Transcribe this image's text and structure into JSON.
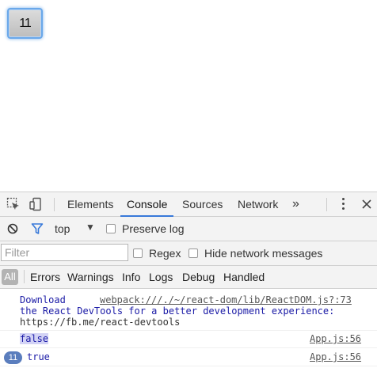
{
  "page": {
    "counter_button_label": "11"
  },
  "devtools": {
    "tabs": [
      "Elements",
      "Console",
      "Sources",
      "Network"
    ],
    "overflow": "»",
    "toolbar": {
      "context": "top",
      "preserve_log": "Preserve log"
    },
    "filter": {
      "placeholder": "Filter",
      "regex": "Regex",
      "hide_network": "Hide network messages"
    },
    "levels": [
      "All",
      "Errors",
      "Warnings",
      "Info",
      "Logs",
      "Debug",
      "Handled"
    ],
    "messages": [
      {
        "text_prefix": "Download ",
        "source": "webpack:///./~/react-dom/lib/ReactDOM.js?:73",
        "line2": "the React DevTools for a better development experience:",
        "line3": "https://fb.me/react-devtools"
      },
      {
        "text": "false",
        "source": "App.js:56"
      },
      {
        "count": "11",
        "text": "true",
        "source": "App.js:56"
      }
    ],
    "colors": {
      "accent": "#3879d9",
      "message_blue": "#1a1aa6",
      "badge": "#5a7dbd"
    }
  }
}
